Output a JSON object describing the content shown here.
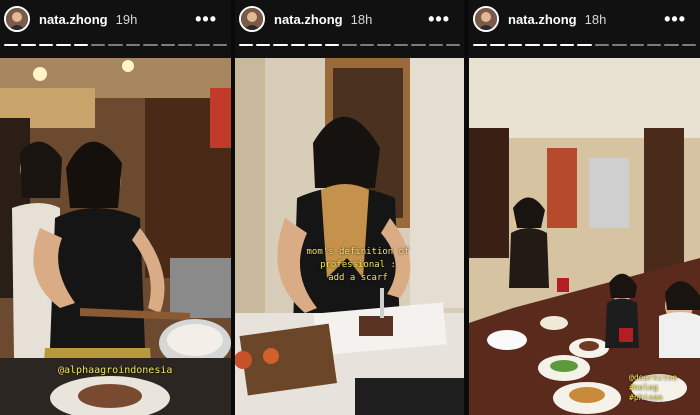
{
  "stories": [
    {
      "username": "nata.zhong",
      "timestamp": "19h",
      "more_icon": "more-horizontal-icon",
      "overlay_tag": "@alphaagroindonesia",
      "progress": [
        1,
        1,
        1,
        1,
        1,
        0,
        0,
        0,
        0,
        0,
        0,
        0,
        0
      ]
    },
    {
      "username": "nata.zhong",
      "timestamp": "18h",
      "more_icon": "more-horizontal-icon",
      "caption_line1": "mom's definition of professional :",
      "caption_line2": "add a scarf",
      "progress": [
        1,
        1,
        1,
        1,
        1,
        1,
        0,
        0,
        0,
        0,
        0,
        0,
        0
      ]
    },
    {
      "username": "nata.zhong",
      "timestamp": "18h",
      "more_icon": "more-horizontal-icon",
      "overlay_tag_line1": "@dearkitoe",
      "overlay_tag_line2": "#nolog",
      "overlay_tag_line3": "#phiseo",
      "progress": [
        1,
        1,
        1,
        1,
        1,
        1,
        1,
        0,
        0,
        0,
        0,
        0,
        0
      ]
    }
  ]
}
